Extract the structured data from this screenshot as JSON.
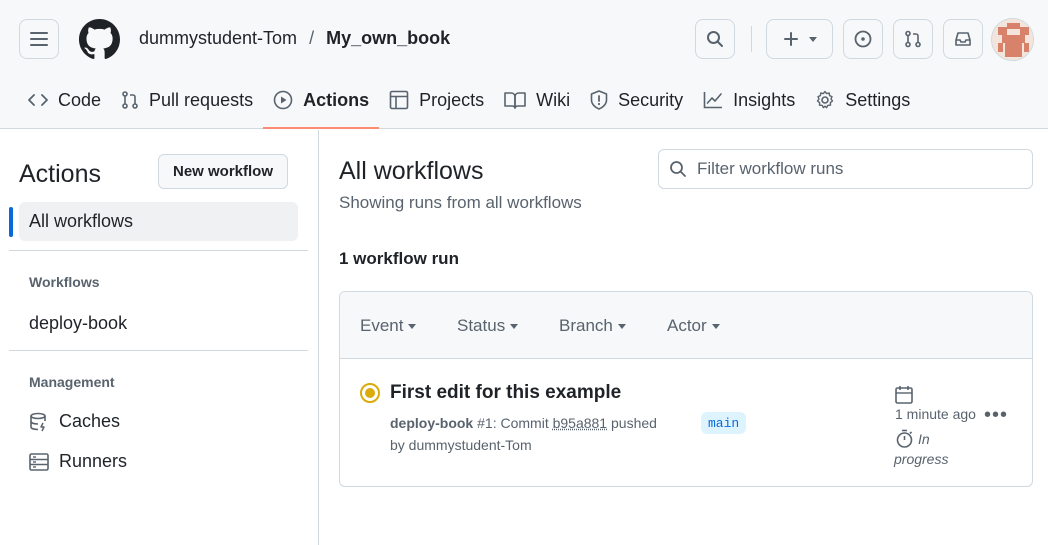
{
  "header": {
    "owner": "dummystudent-Tom",
    "separator": "/",
    "repo": "My_own_book",
    "icons": [
      "menu-icon",
      "github-logo-icon",
      "search-icon",
      "plus-icon",
      "issue-icon",
      "pull-request-icon",
      "inbox-icon"
    ]
  },
  "tabs": [
    {
      "label": "Code",
      "icon": "code-icon"
    },
    {
      "label": "Pull requests",
      "icon": "pull-request-icon"
    },
    {
      "label": "Actions",
      "icon": "play-icon",
      "active": true
    },
    {
      "label": "Projects",
      "icon": "table-icon"
    },
    {
      "label": "Wiki",
      "icon": "book-icon"
    },
    {
      "label": "Security",
      "icon": "shield-icon"
    },
    {
      "label": "Insights",
      "icon": "graph-icon"
    },
    {
      "label": "Settings",
      "icon": "gear-icon"
    }
  ],
  "sidebar": {
    "title": "Actions",
    "new_workflow": "New workflow",
    "all_workflows": "All workflows",
    "workflows_heading": "Workflows",
    "workflows": [
      "deploy-book"
    ],
    "management_heading": "Management",
    "caches": "Caches",
    "runners": "Runners"
  },
  "main": {
    "title": "All workflows",
    "subtitle": "Showing runs from all workflows",
    "filter_placeholder": "Filter workflow runs",
    "run_count": "1 workflow run",
    "filters": [
      "Event",
      "Status",
      "Branch",
      "Actor"
    ]
  },
  "run": {
    "title": "First edit for this example",
    "workflow": "deploy-book",
    "number": "#1",
    "commit_prefix": ": Commit",
    "sha": "b95a881",
    "pushed": "pushed",
    "by": "by dummystudent-Tom",
    "branch": "main",
    "time_ago": "1 minute ago",
    "status": "In progress",
    "status_color": "#dbab09"
  },
  "colors": {
    "accent": "#0969da",
    "tab_underline": "#fd8c73"
  }
}
